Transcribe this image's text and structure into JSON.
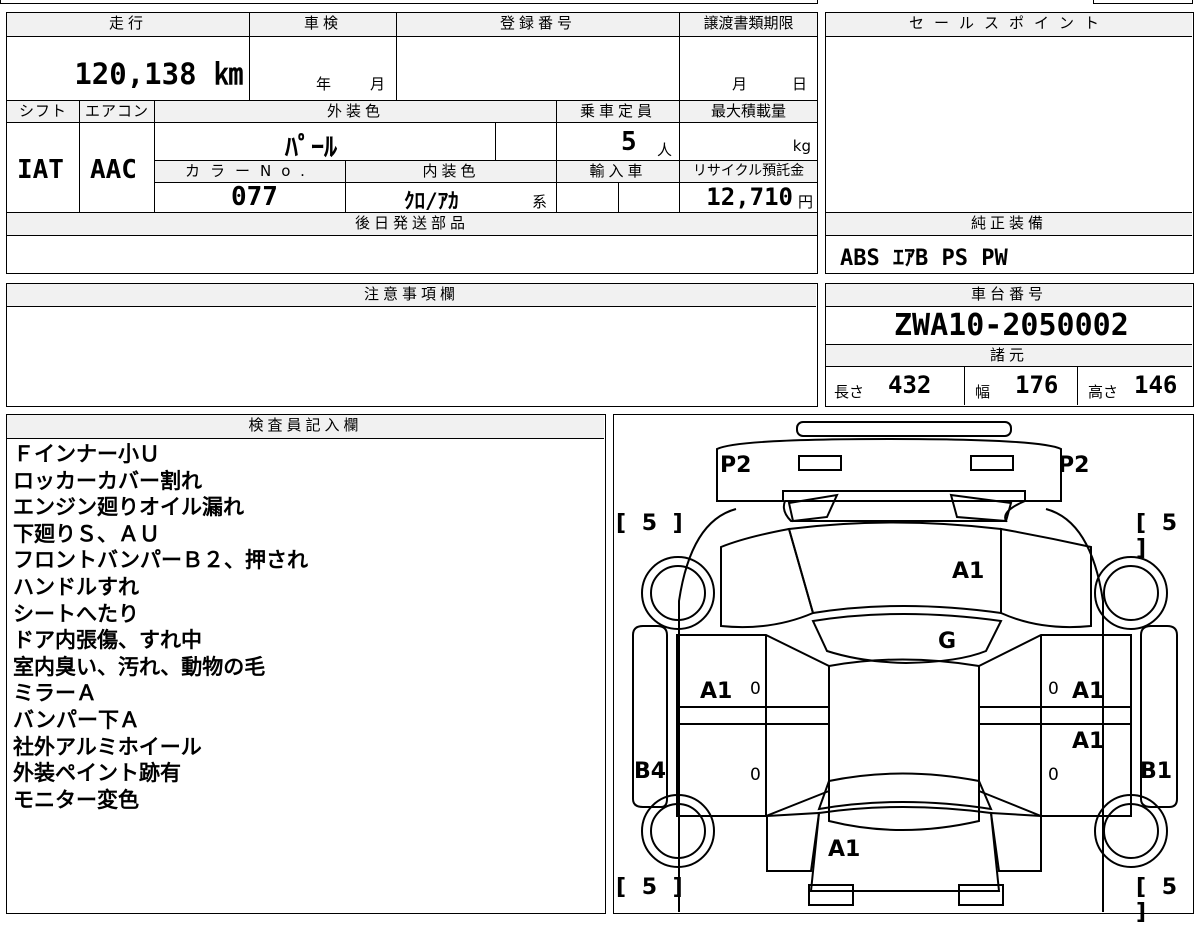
{
  "headers": {
    "mileage": "走行",
    "inspection": "車検",
    "registration": "登録番号",
    "transfer_deadline": "譲渡書類期限",
    "sales_point": "セールスポイント",
    "shift": "シフト",
    "aircon": "エアコン",
    "exterior_color": "外装色",
    "capacity": "乗車定員",
    "max_load": "最大積載量",
    "color_no": "カラーNo.",
    "interior_color": "内装色",
    "imported": "輸入車",
    "recycle": "リサイクル預託金",
    "later_parts": "後日発送部品",
    "genuine_equipment": "純正装備",
    "notes": "注意事項欄",
    "chassis_no": "車台番号",
    "specs": "諸元",
    "inspector": "検査員記入欄"
  },
  "values": {
    "mileage": "120,138 ㎞",
    "year_unit": "年",
    "month_unit": "月",
    "deadline_month": "月",
    "deadline_day": "日",
    "shift": "IAT",
    "aircon": "AAC",
    "exterior_color": "ﾊﾟｰﾙ",
    "capacity": "5",
    "capacity_unit": "人",
    "max_load_unit": "kg",
    "color_no": "077",
    "interior_color": "ｸﾛ/ｱｶ",
    "interior_suffix": "系",
    "recycle": "12,710",
    "recycle_unit": "円",
    "genuine_equipment": "ABS ｴｱB PS PW",
    "chassis_no": "ZWA10-2050002",
    "length_label": "長さ",
    "length": "432",
    "width_label": "幅",
    "width": "176",
    "height_label": "高さ",
    "height": "146"
  },
  "inspector_notes": [
    "Ｆインナー小Ｕ",
    "ロッカーカバー割れ",
    "エンジン廻りオイル漏れ",
    "下廻りＳ、ＡＵ",
    "フロントバンパーＢ２、押され",
    "ハンドルすれ",
    "シートへたり",
    "ドア内張傷、すれ中",
    "室内臭い、汚れ、動物の毛",
    "ミラーＡ",
    "バンパー下Ａ",
    "社外アルミホイール",
    "外装ペイント跡有",
    "モニター変色"
  ],
  "diagram": {
    "p2_left": "P2",
    "p2_right": "P2",
    "tire_fl": "[ 5 ]",
    "tire_fr": "[ 5 ]",
    "tire_rl": "[ 5 ]",
    "tire_rr": "[ 5 ]",
    "hood": "A1",
    "windshield": "G",
    "door_fl": "A1",
    "door_fr": "A1",
    "door_rr": "A1",
    "rear_left": "B4",
    "rear_right": "B1",
    "trunk": "A1",
    "zero1": "0",
    "zero2": "0",
    "zero3": "0",
    "zero4": "0"
  }
}
